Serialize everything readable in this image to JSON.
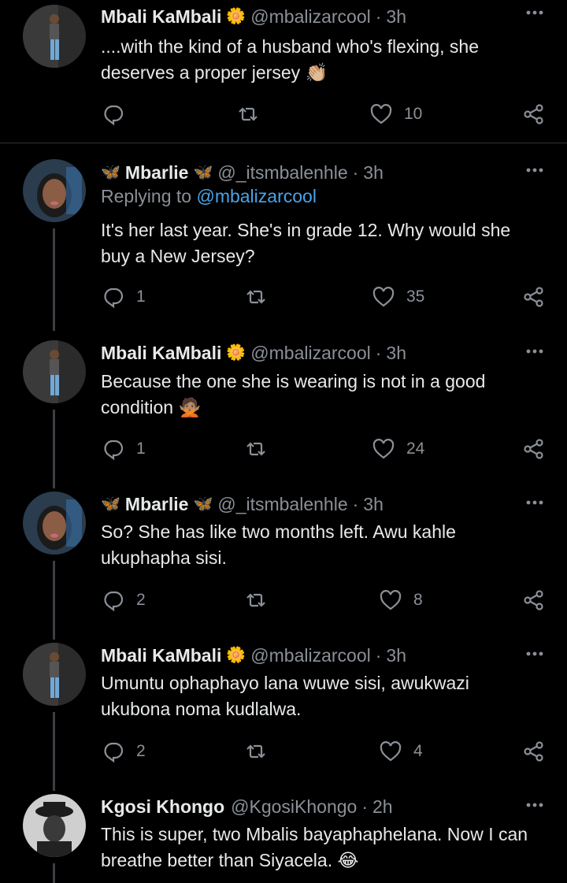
{
  "colors": {
    "background": "#000000",
    "text": "#e7e9ea",
    "muted": "#8b9097",
    "link": "#4aa3e8"
  },
  "tweets": [
    {
      "name": "Mbali KaMbali",
      "name_emoji": "🌼",
      "handle": "@mbalizarcool",
      "time": "3h",
      "replying_label": "",
      "replying_to": "",
      "text": "....with the kind of a husband who's flexing, she deserves a proper jersey 👏🏼",
      "replies": "",
      "retweets": "",
      "likes": "10"
    },
    {
      "name_prefix_emoji": "🦋",
      "name": "Mbarlie",
      "name_emoji": "🦋",
      "handle": "@_itsmbalenhle",
      "time": "3h",
      "replying_label": "Replying to",
      "replying_to": "@mbalizarcool",
      "text": "It's her last year. She's in grade 12. Why would she buy a New Jersey?",
      "replies": "1",
      "retweets": "",
      "likes": "35"
    },
    {
      "name": "Mbali KaMbali",
      "name_emoji": "🌼",
      "handle": "@mbalizarcool",
      "time": "3h",
      "text": "Because the one she is wearing is not in a good condition 🙅🏽",
      "replies": "1",
      "retweets": "",
      "likes": "24"
    },
    {
      "name_prefix_emoji": "🦋",
      "name": "Mbarlie",
      "name_emoji": "🦋",
      "handle": "@_itsmbalenhle",
      "time": "3h",
      "text": "So? She has like two months left. Awu kahle ukuphapha sisi.",
      "replies": "2",
      "retweets": "",
      "likes": "8"
    },
    {
      "name": "Mbali KaMbali",
      "name_emoji": "🌼",
      "handle": "@mbalizarcool",
      "time": "3h",
      "text": "Umuntu ophaphayo lana wuwe sisi, awukwazi ukubona noma kudlalwa.",
      "replies": "2",
      "retweets": "",
      "likes": "4"
    },
    {
      "name": "Kgosi Khongo",
      "handle": "@KgosiKhongo",
      "time": "2h",
      "text": "This is super, two Mbalis bayaphaphelana. Now I can breathe better than Siyacela. 😂"
    }
  ]
}
